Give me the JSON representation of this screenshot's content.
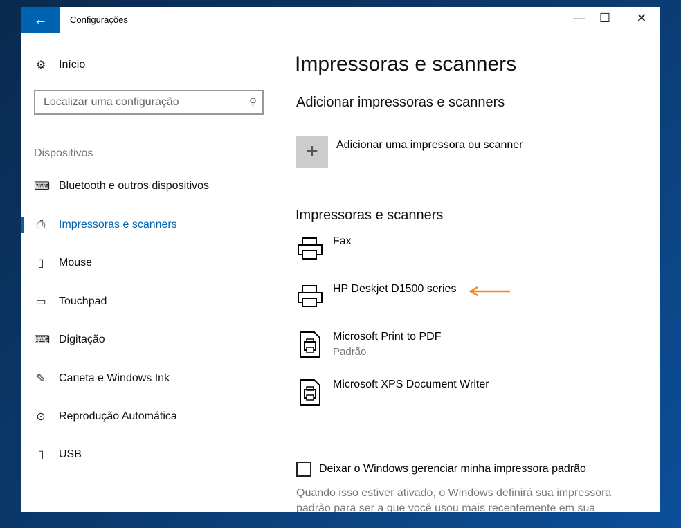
{
  "window": {
    "title": "Configurações",
    "back_icon": "arrow-left-icon"
  },
  "sidebar": {
    "home": "Início",
    "search_placeholder": "Localizar uma configuração",
    "section": "Dispositivos",
    "items": [
      {
        "label": "Bluetooth e outros dispositivos",
        "icon": "bluetooth-devices-icon"
      },
      {
        "label": "Impressoras e scanners",
        "icon": "printer-icon",
        "active": true
      },
      {
        "label": "Mouse",
        "icon": "mouse-icon"
      },
      {
        "label": "Touchpad",
        "icon": "touchpad-icon"
      },
      {
        "label": "Digitação",
        "icon": "keyboard-icon"
      },
      {
        "label": "Caneta e Windows Ink",
        "icon": "pen-icon"
      },
      {
        "label": "Reprodução Automática",
        "icon": "autoplay-icon"
      },
      {
        "label": "USB",
        "icon": "usb-icon"
      }
    ]
  },
  "main": {
    "title": "Impressoras e scanners",
    "add_heading": "Adicionar impressoras e scanners",
    "add_label": "Adicionar uma impressora ou scanner",
    "list_heading": "Impressoras e scanners",
    "printers": [
      {
        "name": "Fax",
        "status": ""
      },
      {
        "name": "HP Deskjet D1500 series",
        "status": ""
      },
      {
        "name": "Microsoft Print to PDF",
        "status": "Padrão"
      },
      {
        "name": "Microsoft XPS Document Writer",
        "status": ""
      }
    ],
    "checkbox_label": "Deixar o Windows gerenciar minha impressora padrão",
    "description": "Quando isso estiver ativado, o Windows definirá sua impressora padrão para ser a que você usou mais recentemente em sua"
  },
  "colors": {
    "accent": "#0063b1",
    "arrow": "#f08c1e"
  }
}
